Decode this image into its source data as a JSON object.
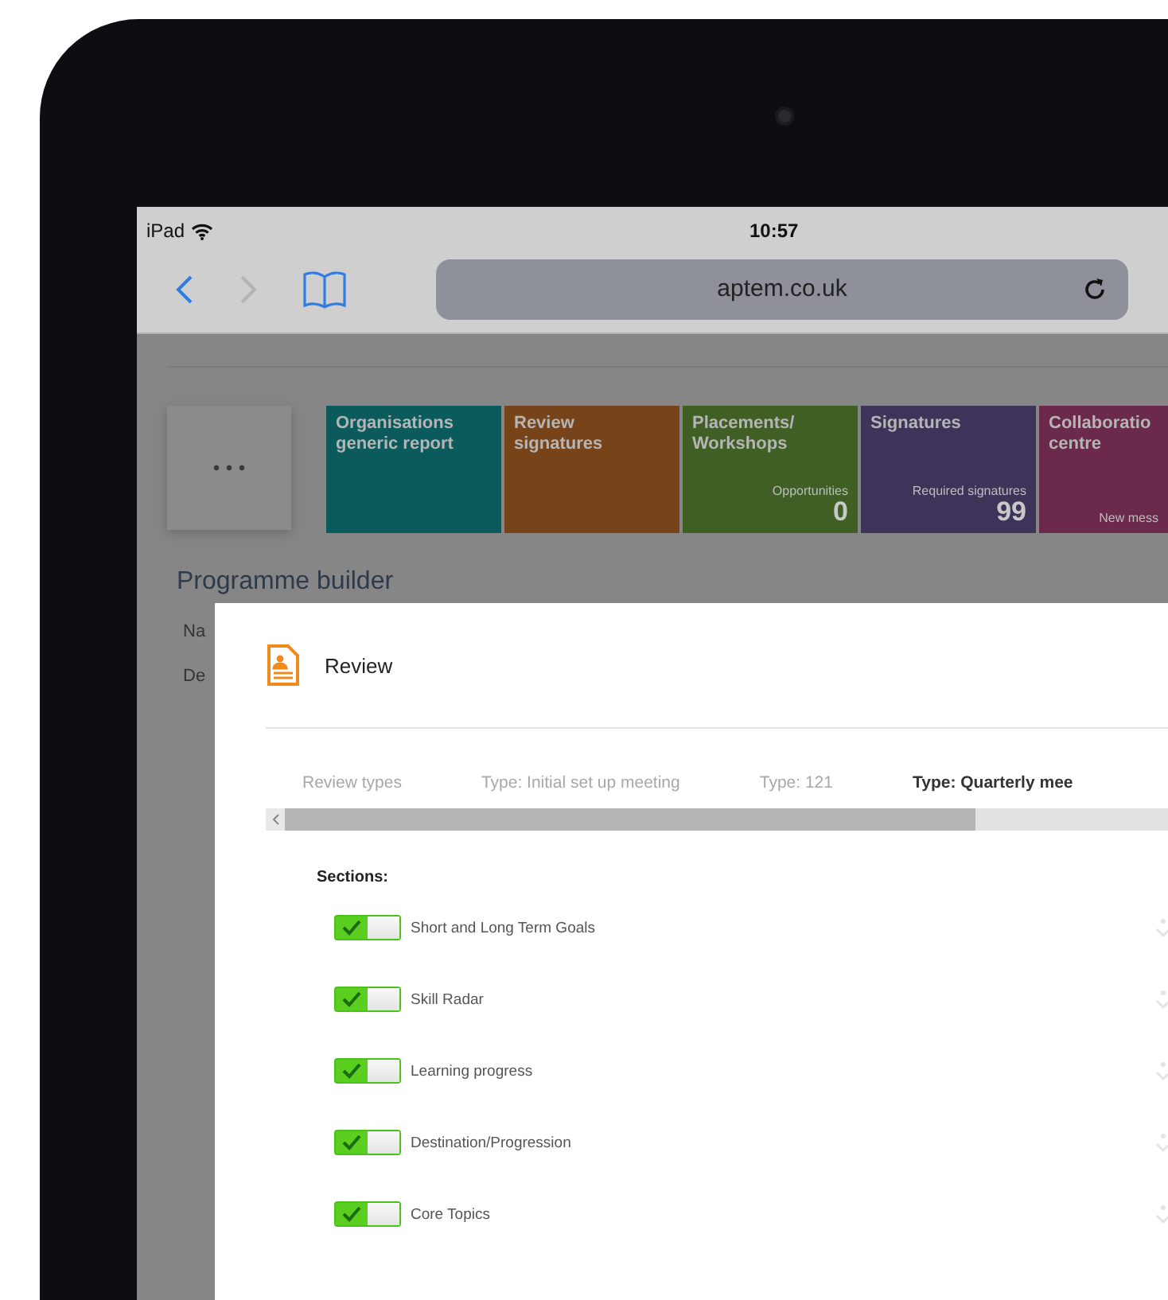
{
  "status_bar": {
    "device": "iPad",
    "time": "10:57"
  },
  "browser": {
    "url": "aptem.co.uk"
  },
  "tiles": [
    {
      "title": "Organisations generic report",
      "color": "#0b5a5c"
    },
    {
      "title": "Review signatures",
      "color": "#77441a"
    },
    {
      "title": "Placements/ Workshops",
      "caption": "Opportunities",
      "count": "0",
      "color": "#3f5f25"
    },
    {
      "title": "Signatures",
      "caption": "Required signatures",
      "count": "99",
      "color": "#3e3359"
    },
    {
      "title": "Collaboratio centre",
      "caption": "New mess",
      "color": "#6b2a4b"
    }
  ],
  "page": {
    "title": "Programme builder",
    "form_labels": [
      "Na",
      "De"
    ]
  },
  "modal": {
    "title": "Review",
    "tabs": [
      {
        "label": "Review types",
        "selected": false
      },
      {
        "label": "Type: Initial set up meeting",
        "selected": false
      },
      {
        "label": "Type: 121",
        "selected": false
      },
      {
        "label": "Type: Quarterly mee",
        "selected": true
      }
    ],
    "sections_label": "Sections:",
    "sections": [
      {
        "label": "Short and Long Term Goals",
        "checked": true
      },
      {
        "label": "Skill Radar",
        "checked": true
      },
      {
        "label": "Learning progress",
        "checked": true
      },
      {
        "label": "Destination/Progression",
        "checked": true
      },
      {
        "label": "Core Topics",
        "checked": true
      }
    ]
  }
}
